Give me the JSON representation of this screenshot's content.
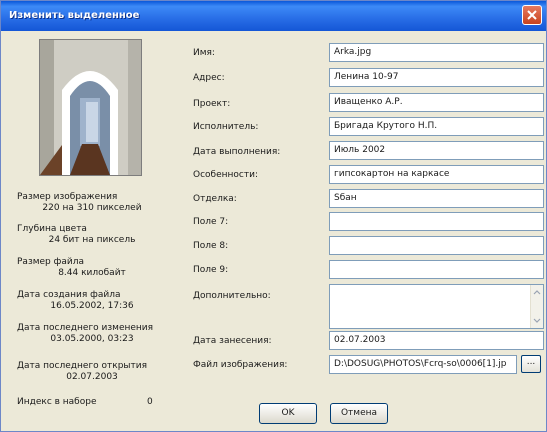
{
  "window": {
    "title": "Изменить выделенное"
  },
  "info": [
    {
      "label": "Размер изображения",
      "value": "220 на 310 пикселей"
    },
    {
      "label": "Глубина цвета",
      "value": "24 бит на пиксель"
    },
    {
      "label": "Размер файла",
      "value": "8.44 килобайт"
    },
    {
      "label": "Дата создания файла",
      "value": "16.05.2002, 17:36"
    },
    {
      "label": "Дата последнего изменения",
      "value": "03.05.2000, 03:23"
    },
    {
      "label": "Дата последнего открытия",
      "value": "02.07.2003"
    }
  ],
  "index": {
    "label": "Индекс в наборе",
    "value": "0"
  },
  "fields": [
    {
      "label": "Имя:",
      "value": "Arka.jpg"
    },
    {
      "label": "Адрес:",
      "value": "Ленина 10-97"
    },
    {
      "label": "Проект:",
      "value": "Иващенко А.Р."
    },
    {
      "label": "Исполнитель:",
      "value": "Бригада Крутого Н.П."
    },
    {
      "label": "Дата выполнения:",
      "value": "Июль 2002"
    },
    {
      "label": "Особенности:",
      "value": "гипсокартон на каркасе"
    },
    {
      "label": "Отделка:",
      "value": "Sбан"
    },
    {
      "label": "Поле 7:",
      "value": ""
    },
    {
      "label": "Поле 8:",
      "value": ""
    },
    {
      "label": "Поле 9:",
      "value": ""
    }
  ],
  "extra": {
    "label": "Дополнительно:",
    "value": ""
  },
  "date_added": {
    "label": "Дата занесения:",
    "value": "02.07.2003"
  },
  "image_file": {
    "label": "Файл изображения:",
    "value": "D:\\DOSUG\\PHOTOS\\Fcrq-so\\0006[1].jp",
    "browse_label": "..."
  },
  "buttons": {
    "ok": "OK",
    "cancel": "Отмена"
  },
  "colors": {
    "titlebar": "#2a70e8",
    "dialog_bg": "#ece9d8",
    "field_border": "#7f9db9"
  }
}
